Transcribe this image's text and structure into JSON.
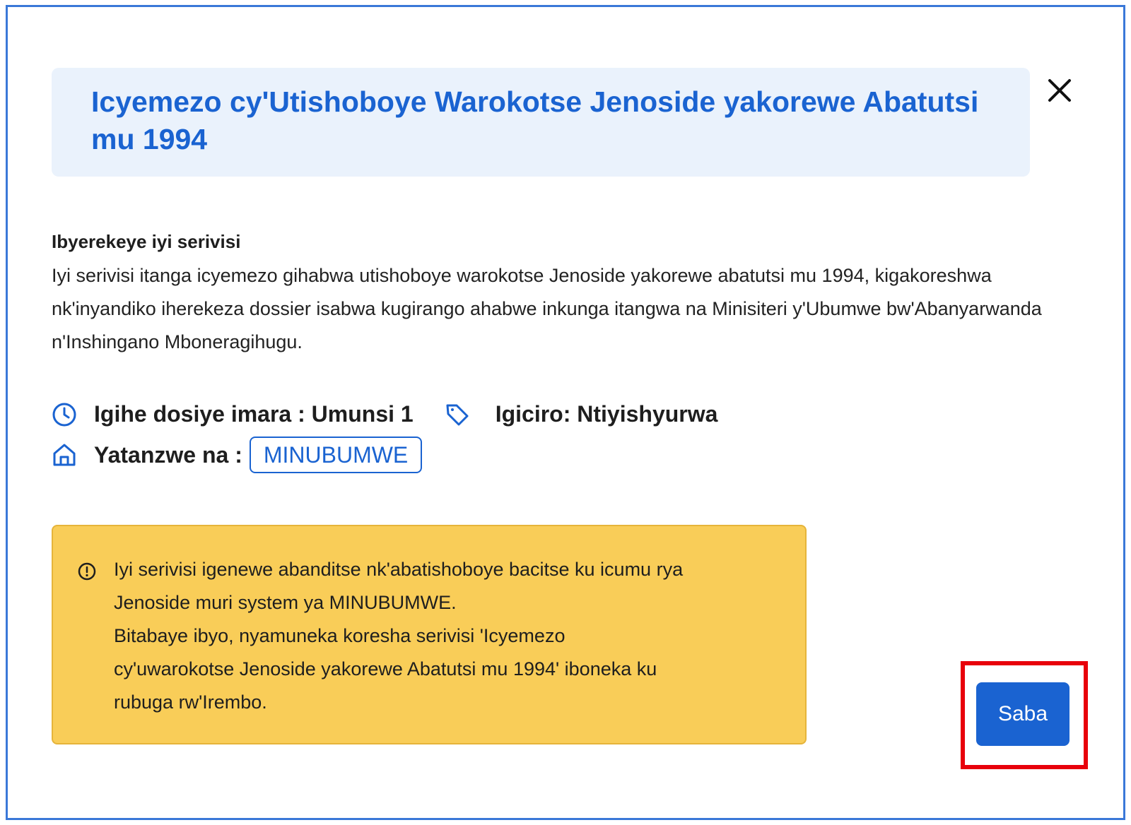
{
  "modal": {
    "title": "Icyemezo cy'Utishoboye Warokotse Jenoside yakorewe Abatutsi mu 1994",
    "close_icon": "close-icon"
  },
  "about": {
    "heading": "Ibyerekeye iyi serivisi",
    "body": "Iyi serivisi itanga icyemezo gihabwa utishoboye warokotse Jenoside yakorewe abatutsi mu 1994, kigakoreshwa nk'inyandiko iherekeza dossier isabwa kugirango ahabwe inkunga itangwa na Minisiteri y'Ubumwe bw'Abanyarwanda n'Inshingano Mboneragihugu."
  },
  "meta": {
    "duration": "Igihe dosiye imara : Umunsi 1",
    "duration_icon": "clock-icon",
    "price": "Igiciro: Ntiyishyurwa",
    "price_icon": "tag-icon",
    "provider_label": "Yatanzwe na :",
    "provider_icon": "home-icon",
    "provider_value": "MINUBUMWE"
  },
  "warning": {
    "icon": "info-circle-icon",
    "text": "Iyi serivisi igenewe abanditse nk'abatishoboye bacitse ku icumu rya\nJenoside muri system ya MINUBUMWE.\nBitabaye ibyo, nyamuneka koresha serivisi 'Icyemezo\ncy'uwarokotse Jenoside yakorewe Abatutsi mu 1994' iboneka ku\nrubuga rw'Irembo."
  },
  "actions": {
    "submit_label": "Saba"
  },
  "colors": {
    "accent": "#1a63d1",
    "title_bg": "#eaf2fc",
    "warning_bg": "#f9cd58",
    "highlight": "#e8000b",
    "frame": "#3a78d8"
  }
}
